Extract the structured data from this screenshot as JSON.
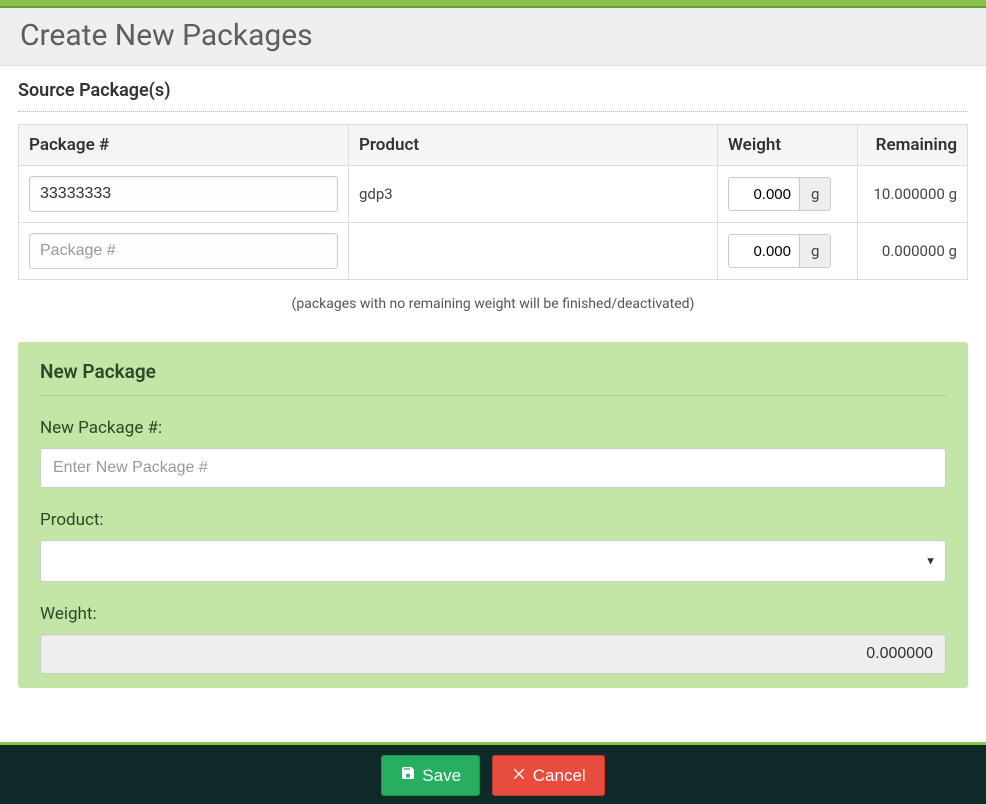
{
  "page_title": "Create New Packages",
  "source_section": {
    "title": "Source Package(s)",
    "columns": {
      "package": "Package #",
      "product": "Product",
      "weight": "Weight",
      "remaining": "Remaining"
    },
    "rows": [
      {
        "package_value": "33333333",
        "package_placeholder": "Package #",
        "product": "gdp3",
        "weight": "0.000",
        "unit": "g",
        "remaining": "10.000000 g"
      },
      {
        "package_value": "",
        "package_placeholder": "Package #",
        "product": "",
        "weight": "0.000",
        "unit": "g",
        "remaining": "0.000000 g"
      }
    ],
    "hint": "(packages with no remaining weight will be finished/deactivated)"
  },
  "new_package": {
    "title": "New Package",
    "fields": {
      "package_number": {
        "label": "New Package #:",
        "placeholder": "Enter New Package #",
        "value": ""
      },
      "product": {
        "label": "Product:",
        "value": ""
      },
      "weight": {
        "label": "Weight:",
        "value": "0.000000"
      }
    }
  },
  "footer": {
    "save": "Save",
    "cancel": "Cancel"
  }
}
